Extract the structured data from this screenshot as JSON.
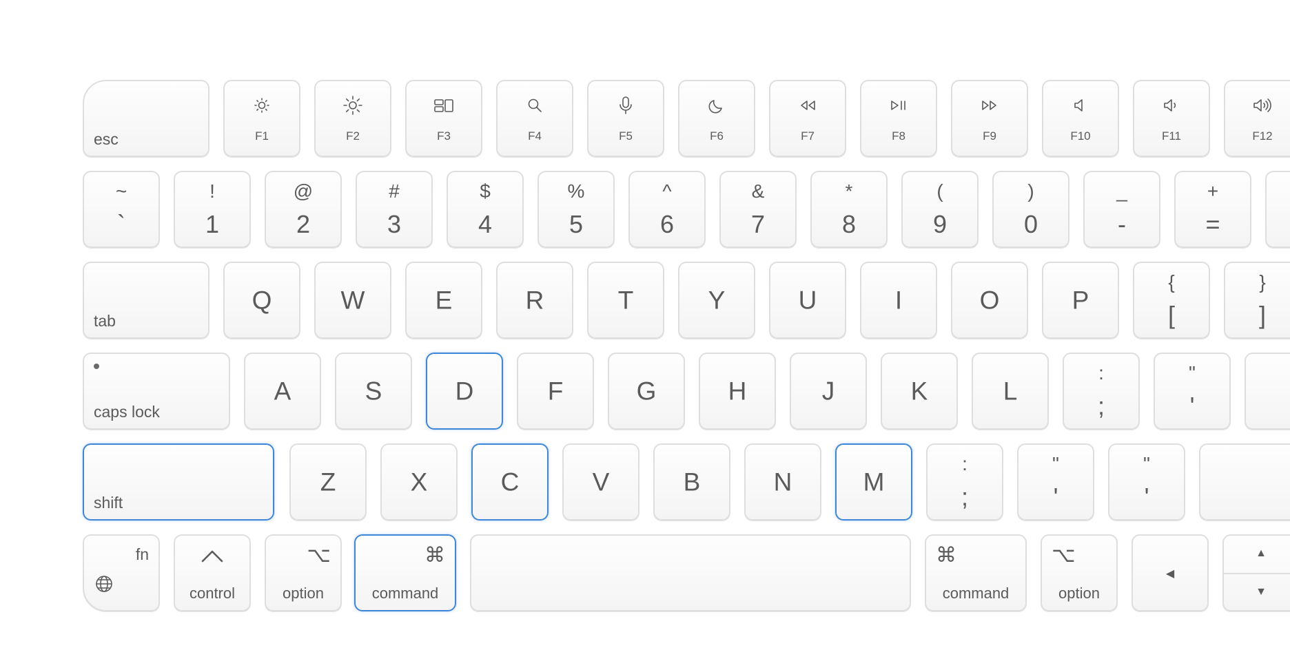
{
  "colors": {
    "highlight": "#3f86d8",
    "key_border": "#dedede",
    "text": "#5a5a5a"
  },
  "fn_row": {
    "esc": "esc",
    "keys": [
      {
        "label": "F1",
        "icon": "brightness-down-icon"
      },
      {
        "label": "F2",
        "icon": "brightness-up-icon"
      },
      {
        "label": "F3",
        "icon": "mission-control-icon"
      },
      {
        "label": "F4",
        "icon": "search-icon"
      },
      {
        "label": "F5",
        "icon": "microphone-icon"
      },
      {
        "label": "F6",
        "icon": "moon-icon"
      },
      {
        "label": "F7",
        "icon": "rewind-icon"
      },
      {
        "label": "F8",
        "icon": "play-pause-icon"
      },
      {
        "label": "F9",
        "icon": "fast-forward-icon"
      },
      {
        "label": "F10",
        "icon": "mute-icon"
      },
      {
        "label": "F11",
        "icon": "volume-down-icon"
      },
      {
        "label": "F12",
        "icon": "volume-up-icon"
      }
    ]
  },
  "number_row": [
    {
      "shift": "~",
      "base": "`"
    },
    {
      "shift": "!",
      "base": "1"
    },
    {
      "shift": "@",
      "base": "2"
    },
    {
      "shift": "#",
      "base": "3"
    },
    {
      "shift": "$",
      "base": "4"
    },
    {
      "shift": "%",
      "base": "5"
    },
    {
      "shift": "^",
      "base": "6"
    },
    {
      "shift": "&",
      "base": "7"
    },
    {
      "shift": "*",
      "base": "8"
    },
    {
      "shift": "(",
      "base": "9"
    },
    {
      "shift": ")",
      "base": "0"
    },
    {
      "shift": "_",
      "base": "-"
    },
    {
      "shift": "+",
      "base": "="
    }
  ],
  "qwerty_row": {
    "tab": "tab",
    "letters": [
      "Q",
      "W",
      "E",
      "R",
      "T",
      "Y",
      "U",
      "I",
      "O",
      "P"
    ],
    "brackets": [
      {
        "shift": "{",
        "base": "["
      },
      {
        "shift": "}",
        "base": "]"
      }
    ]
  },
  "home_row": {
    "caps_lock": "caps lock",
    "letters": [
      "A",
      "S",
      "D",
      "F",
      "G",
      "H",
      "J",
      "K",
      "L"
    ],
    "punct": [
      {
        "shift": ":",
        "base": ";"
      },
      {
        "shift": "\"",
        "base": "'"
      }
    ],
    "highlighted": [
      "D"
    ]
  },
  "shift_row": {
    "shift": "shift",
    "letters": [
      "Z",
      "X",
      "C",
      "V",
      "B",
      "N",
      "M"
    ],
    "punct": [
      {
        "shift": ":",
        "base": ";"
      },
      {
        "shift": "\"",
        "base": "'"
      },
      {
        "shift": "\"",
        "base": "'"
      }
    ],
    "highlighted": [
      "shift",
      "C",
      "M"
    ]
  },
  "bottom_row": {
    "fn": "fn",
    "control": "control",
    "option_left": {
      "symbol": "⌥",
      "label": "option"
    },
    "command_left": {
      "symbol": "⌘",
      "label": "command"
    },
    "command_right": {
      "symbol": "⌘",
      "label": "command"
    },
    "option_right": {
      "symbol": "⌥",
      "label": "option"
    },
    "arrows": {
      "left": "◀",
      "up": "▲",
      "down": "▼"
    },
    "highlighted": [
      "command_left"
    ]
  }
}
